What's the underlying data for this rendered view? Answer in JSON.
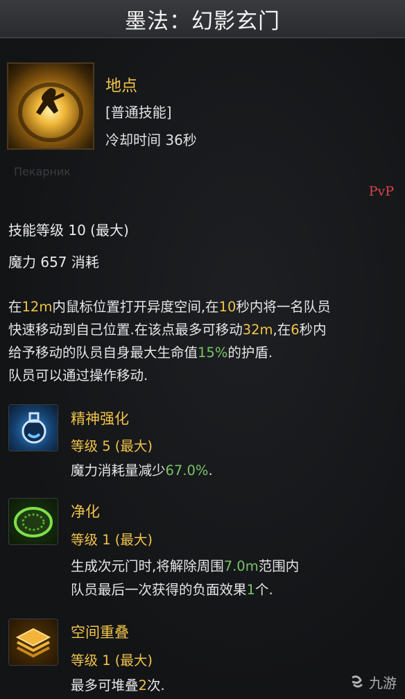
{
  "header": {
    "title": "墨法：幻影玄门"
  },
  "skill": {
    "name": "地点",
    "type": "[普通技能]",
    "cooldown": "冷却时间 36秒",
    "faded_text": "Пекарник",
    "pvp": "PvP",
    "level": "技能等级 10 (最大)",
    "mana": "魔力 657 消耗"
  },
  "description": {
    "p1a": "在",
    "p1b": "12m",
    "p1c": "内鼠标位置打开异度空间,在",
    "p1d": "10",
    "p1e": "秒内将一名队员",
    "p2a": "快速移动到自己位置.在该点最多可移动",
    "p2b": "32m",
    "p2c": ",在",
    "p2d": "6",
    "p2e": "秒内",
    "p3a": "给予移动的队员自身最大生命值",
    "p3b": "15%",
    "p3c": "的护盾.",
    "p4": "队员可以通过操作移动."
  },
  "tripods": [
    {
      "name": "精神强化",
      "level": "等级 5 (最大)",
      "d1a": "魔力消耗量减少",
      "d1b": "67.0%",
      "d1c": "."
    },
    {
      "name": "净化",
      "level": "等级 1 (最大)",
      "d1a": "生成次元门时,将解除周围",
      "d1b": "7.0m",
      "d1c": "范围内",
      "d2a": "队员最后一次获得的负面效果",
      "d2b": "1",
      "d2c": "个."
    },
    {
      "name": "空间重叠",
      "level": "等级 1 (最大)",
      "d1a": "最多可堆叠",
      "d1b": "2",
      "d1c": "次."
    }
  ],
  "watermark": {
    "text": "九游"
  },
  "colors": {
    "accent": "#f1c44a",
    "highlight_green": "#79c46a",
    "pvp": "#d8444a"
  }
}
